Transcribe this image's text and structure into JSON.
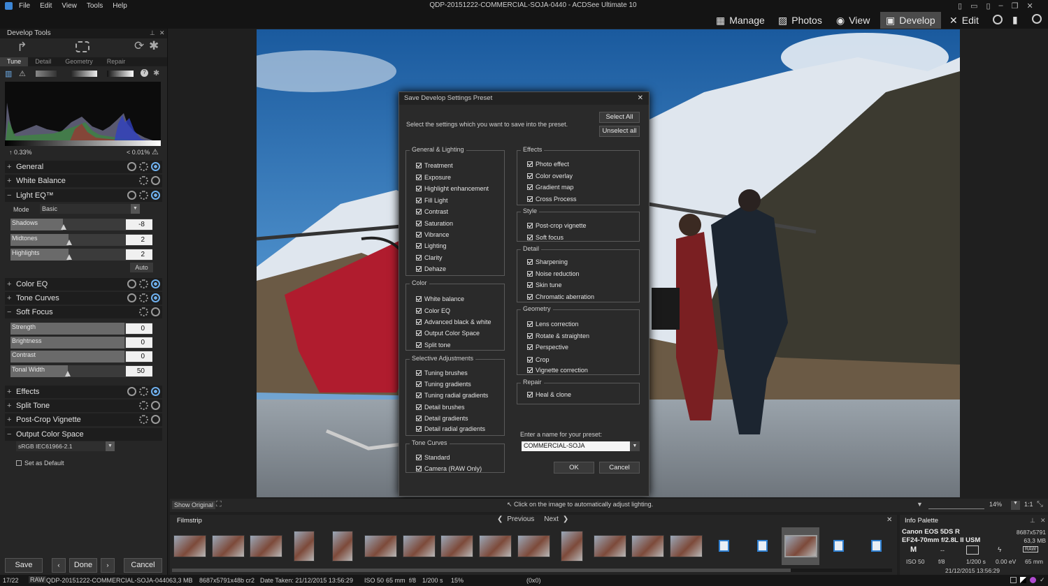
{
  "app": {
    "title": "QDP-20151222-COMMERCIAL-SOJA-0440 - ACDSee Ultimate 10",
    "menu": [
      "File",
      "Edit",
      "View",
      "Tools",
      "Help"
    ]
  },
  "modes": [
    "Manage",
    "Photos",
    "View",
    "Develop",
    "Edit"
  ],
  "dev": {
    "title": "Develop Tools",
    "tabs": [
      "Tune",
      "Detail",
      "Geometry",
      "Repair"
    ],
    "hist_left": "0.33%",
    "hist_right": "< 0.01%",
    "sections": {
      "general": "General",
      "wb": "White Balance",
      "lighteq": "Light EQ™",
      "coloreq": "Color EQ",
      "tonecurves": "Tone Curves",
      "softfocus": "Soft Focus",
      "effects": "Effects",
      "splittone": "Split Tone",
      "postcrop": "Post-Crop Vignette",
      "ocs": "Output Color Space"
    },
    "mode_label": "Mode",
    "mode_value": "Basic",
    "light": {
      "shadows": {
        "label": "Shadows",
        "value": "-8"
      },
      "midtones": {
        "label": "Midtones",
        "value": "2"
      },
      "highlights": {
        "label": "Highlights",
        "value": "2"
      },
      "auto": "Auto"
    },
    "soft": {
      "strength": {
        "label": "Strength",
        "value": "0"
      },
      "brightness": {
        "label": "Brightness",
        "value": "0"
      },
      "contrast": {
        "label": "Contrast",
        "value": "0"
      },
      "tonal": {
        "label": "Tonal Width",
        "value": "50"
      }
    },
    "ocs_value": "sRGB IEC61966-2.1",
    "set_default": "Set as Default",
    "buttons": {
      "save": "Save",
      "done": "Done",
      "cancel": "Cancel"
    }
  },
  "dialog": {
    "title": "Save Develop Settings Preset",
    "instr": "Select the settings which you want to save into the preset.",
    "select_all": "Select All",
    "unselect_all": "Unselect all",
    "groups": {
      "general": {
        "title": "General & Lighting",
        "items": [
          "Treatment",
          "Exposure",
          "Highlight enhancement",
          "Fill Light",
          "Contrast",
          "Saturation",
          "Vibrance",
          "Lighting",
          "Clarity",
          "Dehaze"
        ]
      },
      "color": {
        "title": "Color",
        "items": [
          "White balance",
          "Color EQ",
          "Advanced black & white",
          "Output Color Space",
          "Split tone"
        ]
      },
      "selective": {
        "title": "Selective Adjustments",
        "items": [
          "Tuning brushes",
          "Tuning gradients",
          "Tuning radial gradients",
          "Detail brushes",
          "Detail gradients",
          "Detail radial gradients"
        ]
      },
      "tone": {
        "title": "Tone Curves",
        "items": [
          "Standard",
          "Camera (RAW Only)"
        ]
      },
      "effects": {
        "title": "Effects",
        "items": [
          "Photo effect",
          "Color overlay",
          "Gradient map",
          "Cross Process"
        ]
      },
      "style": {
        "title": "Style",
        "items": [
          "Post-crop vignette",
          "Soft focus"
        ]
      },
      "detail": {
        "title": "Detail",
        "items": [
          "Sharpening",
          "Noise reduction",
          "Skin tune",
          "Chromatic aberration"
        ]
      },
      "geometry": {
        "title": "Geometry",
        "items": [
          "Lens correction",
          "Rotate & straighten",
          "Perspective",
          "Crop",
          "Vignette correction"
        ]
      },
      "repair": {
        "title": "Repair",
        "items": [
          "Heal & clone"
        ]
      }
    },
    "name_label": "Enter a name for your preset:",
    "name_value": "COMMERCIAL-SOJA",
    "ok": "OK",
    "cancel": "Cancel"
  },
  "viewer": {
    "show_original": "Show Original",
    "hint": "Click on the image to automatically adjust lighting.",
    "zoom": "14%",
    "ratio": "1:1"
  },
  "filmstrip": {
    "title": "Filmstrip",
    "prev": "Previous",
    "next": "Next"
  },
  "info": {
    "title": "Info Palette",
    "camera": "Canon EOS 5DS R",
    "dims": "8687x5791",
    "lens": "EF24-70mm f/2.8L II USM",
    "size": "63,3 MB",
    "mode": "M",
    "dash": "--",
    "raw": "RAW",
    "iso": "ISO 50",
    "fnum": "f/8",
    "shutter": "1/200 s",
    "ev": "0.00 eV",
    "focal": "65 mm",
    "date": "21/12/2015 13:56:29"
  },
  "status": {
    "count": "17/22",
    "fmt": "RAW",
    "file": "QDP-20151222-COMMERCIAL-SOJA-0440",
    "size": "63,3 MB",
    "dims": "8687x5791x48b cr2",
    "date": "Date Taken: 21/12/2015 13:56:29",
    "iso": "ISO 50",
    "focal": "65 mm",
    "fnum": "f/8",
    "shutter": "1/200 s",
    "zoom": "15%",
    "coords": "(0x0)"
  }
}
